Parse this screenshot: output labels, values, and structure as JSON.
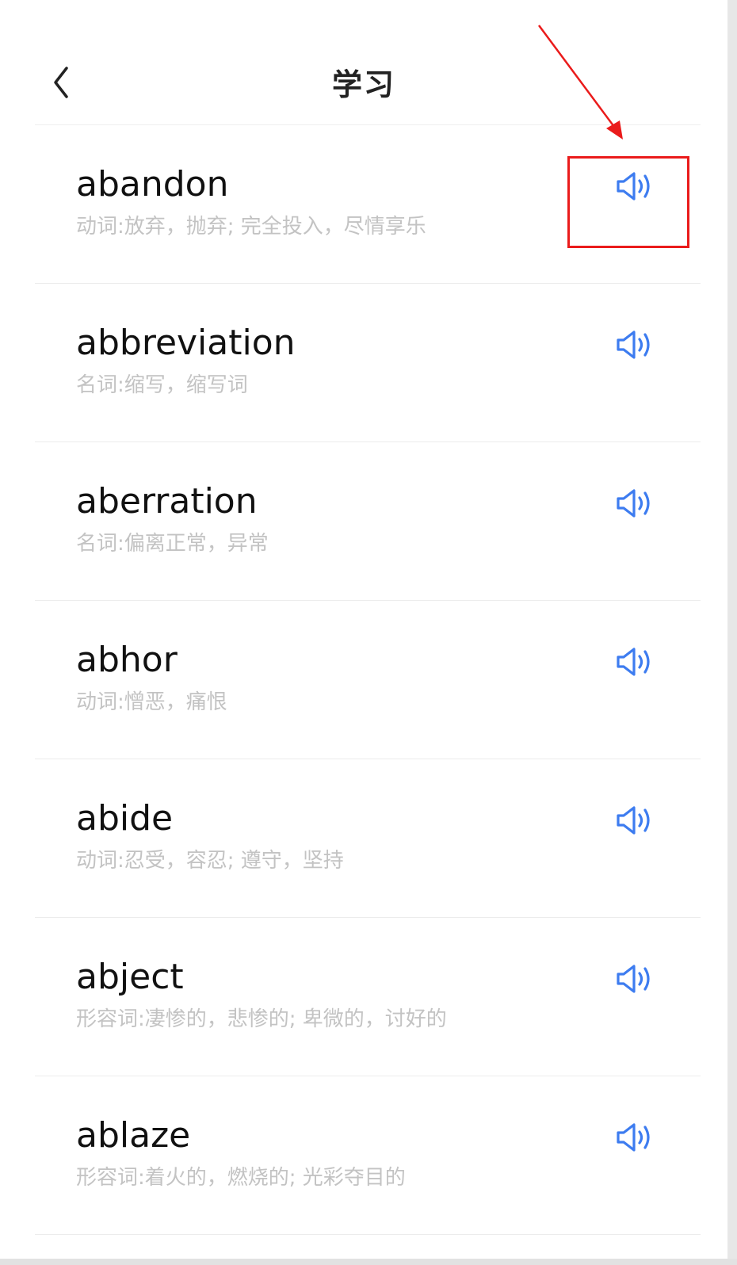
{
  "header": {
    "title": "学习",
    "back_icon": "chevron-left-icon"
  },
  "colors": {
    "accent": "#3d7cf0",
    "annotation": "#ea1b1b",
    "word_text": "#111111",
    "meaning_text": "#c3c3c3"
  },
  "words": [
    {
      "word": "abandon",
      "meaning": "动词:放弃，抛弃; 完全投入，尽情享乐",
      "icon": "speaker-icon"
    },
    {
      "word": "abbreviation",
      "meaning": "名词:缩写，缩写词",
      "icon": "speaker-icon"
    },
    {
      "word": "aberration",
      "meaning": "名词:偏离正常，异常",
      "icon": "speaker-icon"
    },
    {
      "word": "abhor",
      "meaning": "动词:憎恶，痛恨",
      "icon": "speaker-icon"
    },
    {
      "word": "abide",
      "meaning": "动词:忍受，容忍; 遵守，坚持",
      "icon": "speaker-icon"
    },
    {
      "word": "abject",
      "meaning": "形容词:凄惨的，悲惨的; 卑微的，讨好的",
      "icon": "speaker-icon"
    },
    {
      "word": "ablaze",
      "meaning": "形容词:着火的，燃烧的; 光彩夺目的",
      "icon": "speaker-icon"
    }
  ]
}
